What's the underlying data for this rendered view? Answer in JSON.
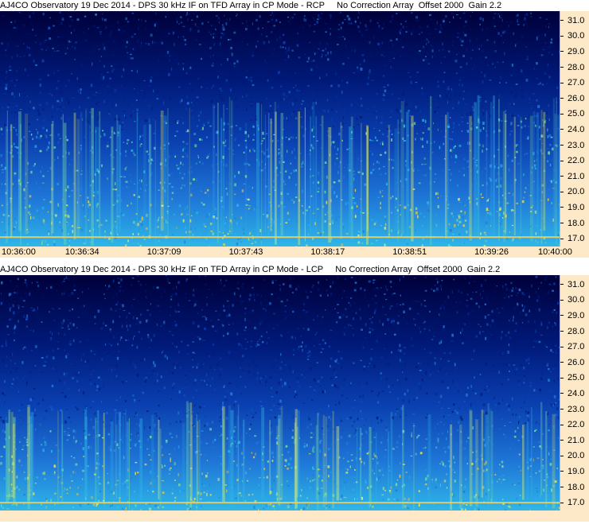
{
  "chart_data": [
    {
      "type": "heatmap",
      "title": "AJ4CO Observatory 19 Dec 2014 - DPS 30 kHz IF on TFD Array in CP Mode - RCP     No Correction Array  Offset 2000  Gain 2.2",
      "y_ticks": [
        "31.0",
        "30.0",
        "29.0",
        "28.0",
        "27.0",
        "26.0",
        "25.0",
        "24.0",
        "23.0",
        "22.0",
        "21.0",
        "20.0",
        "19.0",
        "18.0",
        "17.0"
      ],
      "ylim": [
        16.5,
        31.6
      ],
      "x_ticks": [
        "10:36:00",
        "10:36:34",
        "10:37:09",
        "10:37:43",
        "10:38:17",
        "10:38:51",
        "10:39:26",
        "10:40:00"
      ],
      "interference_line_mhz": 17.1,
      "bright_region_top_mhz": [
        24.2,
        24.0,
        24.6,
        24.3,
        24.0,
        24.8,
        24.8,
        24.3
      ]
    },
    {
      "type": "heatmap",
      "title": "AJ4CO Observatory 19 Dec 2014 - DPS 30 kHz IF on TFD Array in CP Mode - LCP     No Correction Array  Offset 2000  Gain 2.2",
      "y_ticks": [
        "31.0",
        "30.0",
        "29.0",
        "28.0",
        "27.0",
        "26.0",
        "25.0",
        "24.0",
        "23.0",
        "22.0",
        "21.0",
        "20.0",
        "19.0",
        "18.0",
        "17.0"
      ],
      "ylim": [
        16.5,
        31.6
      ],
      "x_ticks": [],
      "interference_line_mhz": 17.0,
      "bright_region_top_mhz": [
        22.0,
        21.5,
        22.0,
        21.8,
        21.5,
        22.0,
        22.0,
        21.2
      ]
    }
  ],
  "colors": {
    "axis_bg": "#fde9c8",
    "colormap": [
      "#00003a",
      "#001a7a",
      "#0a3fb0",
      "#1f78d8",
      "#2fb6e8",
      "#7be0a0",
      "#e8f060",
      "#ffd040"
    ],
    "interference_line": "#f0d060"
  }
}
